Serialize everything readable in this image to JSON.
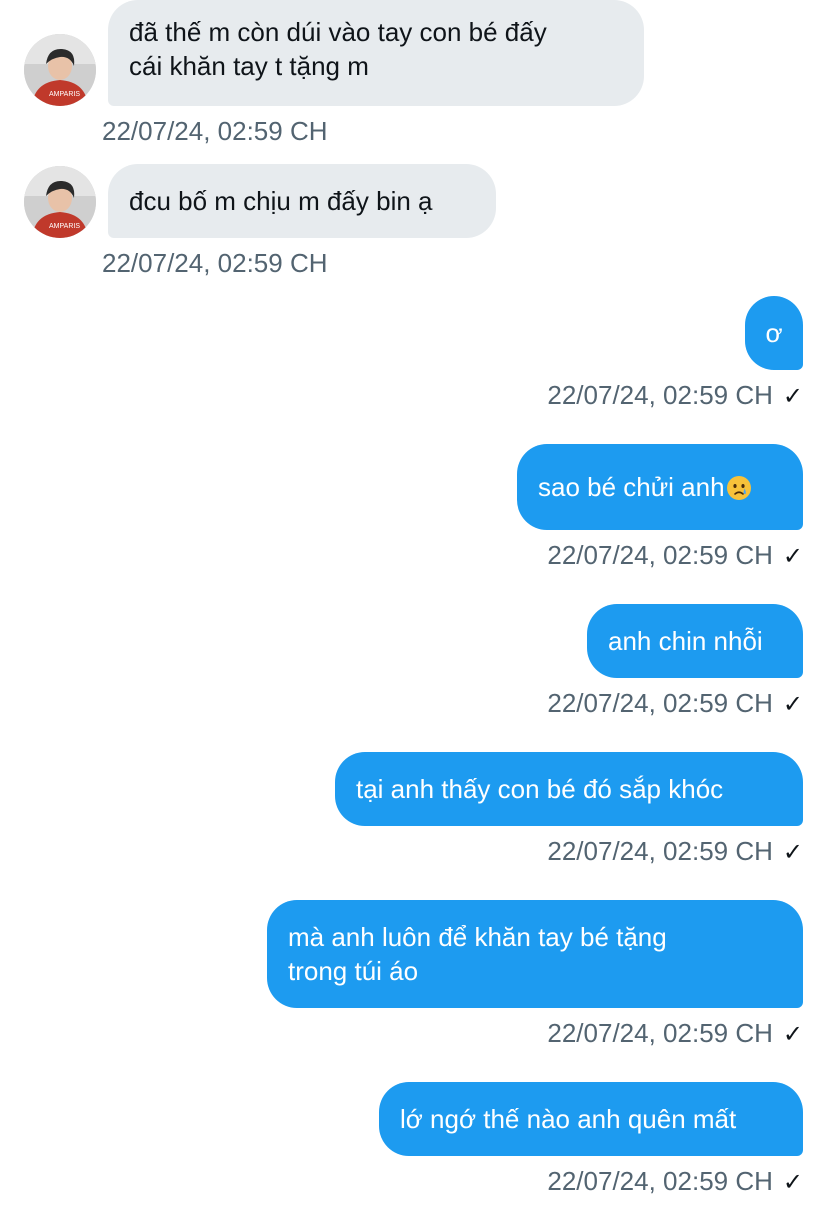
{
  "conversation": {
    "messages": [
      {
        "direction": "in",
        "text": "đã thế m còn dúi vào tay con bé đấy cái khăn tay t tặng m",
        "line1": "đã thế m còn dúi vào tay con bé đấy",
        "line2": "cái khăn tay t tặng m",
        "timestamp": "22/07/24, 02:59 CH"
      },
      {
        "direction": "in",
        "text": "đcu bố m chịu m đấy bin ạ",
        "timestamp": "22/07/24, 02:59 CH"
      },
      {
        "direction": "out",
        "text": "ơ",
        "timestamp": "22/07/24, 02:59 CH"
      },
      {
        "direction": "out",
        "text": "sao bé chửi anh",
        "emoji": "crying-face-emoji",
        "timestamp": "22/07/24, 02:59 CH"
      },
      {
        "direction": "out",
        "text": "anh chin nhỗi",
        "timestamp": "22/07/24, 02:59 CH"
      },
      {
        "direction": "out",
        "text": "tại anh thấy con bé đó sắp khóc",
        "timestamp": "22/07/24, 02:59 CH"
      },
      {
        "direction": "out",
        "text": "mà anh luôn để khăn tay bé tặng trong túi áo",
        "line1": "mà anh luôn để khăn tay bé tặng",
        "line2": "trong túi áo",
        "timestamp": "22/07/24, 02:59 CH"
      },
      {
        "direction": "out",
        "text": "lớ ngớ thế nào anh quên mất",
        "timestamp": "22/07/24, 02:59 CH"
      }
    ],
    "read_mark": "✓"
  },
  "colors": {
    "outgoing_bubble": "#1d9bf0",
    "incoming_bubble": "#e7ebee",
    "timestamp": "#536471"
  }
}
